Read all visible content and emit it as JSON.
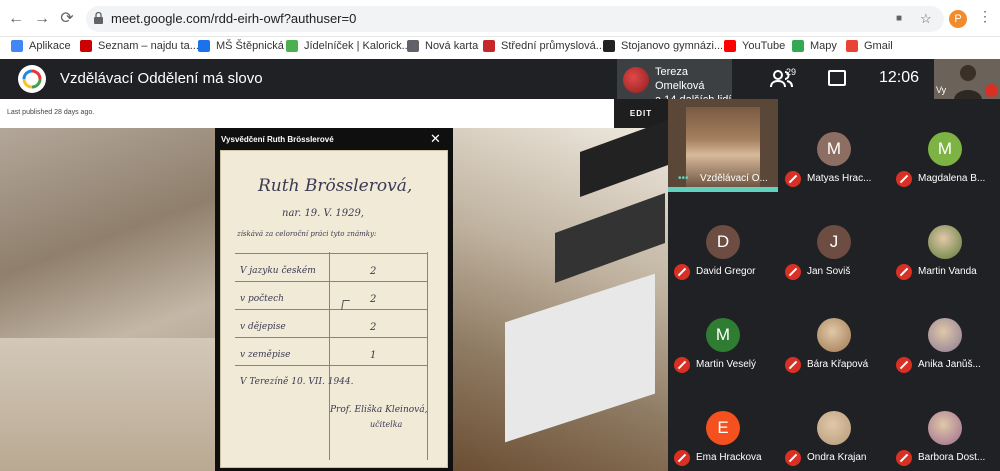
{
  "browser": {
    "url": "meet.google.com/rdd-eirh-owf?authuser=0",
    "profile_initial": "P",
    "back": "←",
    "forward": "→",
    "reload": "⟳",
    "menu": "⋮",
    "camera": "■",
    "star": "☆"
  },
  "bookmarks": [
    {
      "label": "Aplikace",
      "icon": "apps-icon",
      "color": "#4285f4"
    },
    {
      "label": "Seznam – najdu ta...",
      "icon": "seznam-icon",
      "color": "#cc0000"
    },
    {
      "label": "MŠ Štěpnická",
      "icon": "ms-icon",
      "color": "#1a73e8"
    },
    {
      "label": "Jídelníček | Kalorick...",
      "icon": "jidelnicek-icon",
      "color": "#4caf50"
    },
    {
      "label": "Nová karta",
      "icon": "globe-icon",
      "color": "#5f6368"
    },
    {
      "label": "Střední průmyslová...",
      "icon": "school-icon",
      "color": "#c62828"
    },
    {
      "label": "Stojanovo gymnázi...",
      "icon": "gymnazium-icon",
      "color": "#222222"
    },
    {
      "label": "YouTube",
      "icon": "youtube-icon",
      "color": "#ff0000"
    },
    {
      "label": "Mapy",
      "icon": "maps-icon",
      "color": "#34a853"
    },
    {
      "label": "Gmail",
      "icon": "gmail-icon",
      "color": "#ea4335"
    }
  ],
  "meet": {
    "title": "Vzdělávací Oddělení má slovo",
    "presenter_line1": "Tereza Omelková",
    "presenter_line2": "a 14 dalších lidí",
    "people_count": "29",
    "clock": "12:06",
    "self_label": "Vy"
  },
  "share": {
    "published": "Last published 28 days ago.",
    "edit_label": "EDIT",
    "modal_title": "Vysvědčení Ruth Brösslerové",
    "close": "✕",
    "doc": {
      "name": "Ruth Brösslerová,",
      "birth": "nar. 19. V. 1929,",
      "intro": "získává za celoroční práci tyto známky:",
      "rows": [
        {
          "subject": "V jazyku českém",
          "grade": "2"
        },
        {
          "subject": "v počtech",
          "grade": "2"
        },
        {
          "subject": "v dějepise",
          "grade": "2"
        },
        {
          "subject": "v zeměpise",
          "grade": "1"
        }
      ],
      "place_date": "V Terezíně 10. VII. 1944.",
      "signature": "Prof. Eliška Kleinová,",
      "role": "učitelka"
    }
  },
  "participants": [
    {
      "name": "Vzdělávací O...",
      "featured": true
    },
    {
      "name": "Matyas Hrac...",
      "initial": "M",
      "color": "#8d6e63"
    },
    {
      "name": "Magdalena B...",
      "initial": "M",
      "color": "#7cb342"
    },
    {
      "name": "David Gregor",
      "initial": "D",
      "color": "#6d4c41"
    },
    {
      "name": "Jan Soviš",
      "initial": "J",
      "color": "#6d4c41"
    },
    {
      "name": "Martin Vanda",
      "photo": "#5d7a3a"
    },
    {
      "name": "Martin Veselý",
      "initial": "M",
      "color": "#2e7d32"
    },
    {
      "name": "Bára Křapová",
      "photo": "#a07850"
    },
    {
      "name": "Anika Janůš...",
      "photo": "#8a7a96"
    },
    {
      "name": "Ema Hrackova",
      "initial": "E",
      "color": "#f4511e"
    },
    {
      "name": "Ondra Krajan",
      "photo": "#b79a7a"
    },
    {
      "name": "Barbora Dost...",
      "photo": "#9c6b8e"
    }
  ]
}
